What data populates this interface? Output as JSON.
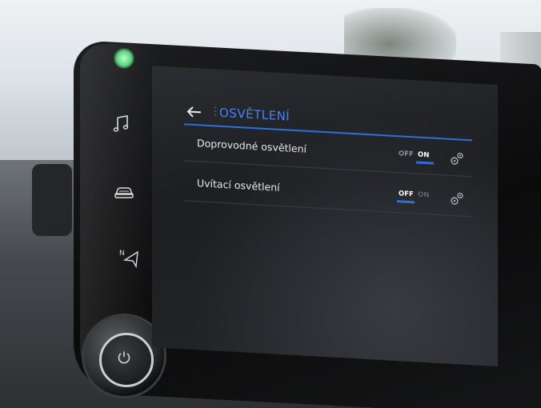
{
  "screen": {
    "title": "OSVĚTLENÍ",
    "settings": [
      {
        "label": "Doprovodné osvětlení",
        "toggle": {
          "off_label": "OFF",
          "on_label": "ON",
          "state": "on"
        }
      },
      {
        "label": "Uvítací osvětlení",
        "toggle": {
          "off_label": "OFF",
          "on_label": "ON",
          "state": "off"
        }
      }
    ]
  },
  "side_icons": [
    "music-icon",
    "car-icon",
    "navigation-icon"
  ],
  "colors": {
    "accent": "#3c84ff",
    "toggle_bar": "#2f6fd6",
    "screen_bg": "#1f2124",
    "text": "#e7e9ec"
  }
}
